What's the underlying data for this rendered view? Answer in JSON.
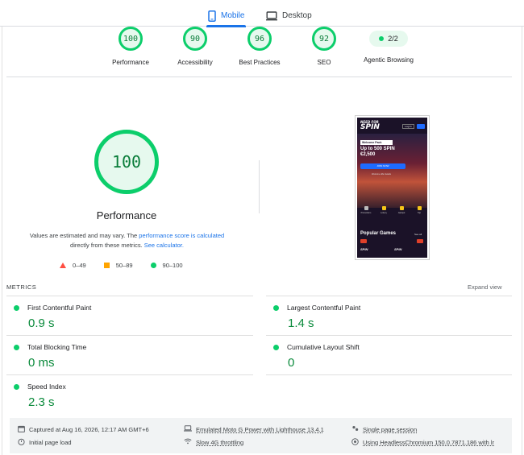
{
  "tabs": [
    {
      "label": "Mobile",
      "icon": "phone-icon",
      "active": true
    },
    {
      "label": "Desktop",
      "icon": "desktop-icon",
      "active": false
    }
  ],
  "scores": [
    {
      "label": "Performance",
      "value": "100"
    },
    {
      "label": "Accessibility",
      "value": "90"
    },
    {
      "label": "Best Practices",
      "value": "96"
    },
    {
      "label": "SEO",
      "value": "92"
    },
    {
      "label": "Agentic Browsing",
      "value": "2/2"
    }
  ],
  "main": {
    "score": "100",
    "title": "Performance",
    "note_pre": "Values are estimated and may vary. The ",
    "note_link1": "performance score is calculated",
    "note_mid": " directly from these metrics. ",
    "note_link2": "See calculator."
  },
  "legend": [
    {
      "label": "0–49",
      "color": "#ff4e42"
    },
    {
      "label": "50–89",
      "color": "#ffa400"
    },
    {
      "label": "90–100",
      "color": "#0cce6b"
    }
  ],
  "screenshot": {
    "logo_top": "NEED FOR",
    "logo_main": "SPIN",
    "login": "Log in",
    "welcome": "Welcome Pack",
    "offer": "Up to 500 SPIN",
    "offer_amount": "€2,500",
    "join": "JOIN NOW",
    "fine_print": "Welcome offer details",
    "categories": [
      "Promotions",
      "Lottery",
      "Jackpot",
      "Top"
    ],
    "popular": "Popular Games",
    "see_all": "See all",
    "brand": "SPIN"
  },
  "metrics": {
    "title": "METRICS",
    "expand": "Expand view",
    "items": [
      {
        "label": "First Contentful Paint",
        "value": "0.9 s"
      },
      {
        "label": "Largest Contentful Paint",
        "value": "1.4 s"
      },
      {
        "label": "Total Blocking Time",
        "value": "0 ms"
      },
      {
        "label": "Cumulative Layout Shift",
        "value": "0"
      },
      {
        "label": "Speed Index",
        "value": "2.3 s"
      }
    ]
  },
  "footer": {
    "captured": "Captured at Aug 16, 2026, 12:17 AM GMT+6",
    "initial": "Initial page load",
    "device": "Emulated Moto G Power with Lighthouse 13.4.1",
    "throttling": "Slow 4G throttling",
    "session": "Single page session",
    "browser": "Using HeadlessChromium 150.0.7871.186 with lr"
  },
  "colors": {
    "pass": "#0cce6b",
    "pass_text": "#0a8a3b",
    "accent": "#1a73e8",
    "fail": "#ff4e42",
    "average": "#ffa400"
  }
}
